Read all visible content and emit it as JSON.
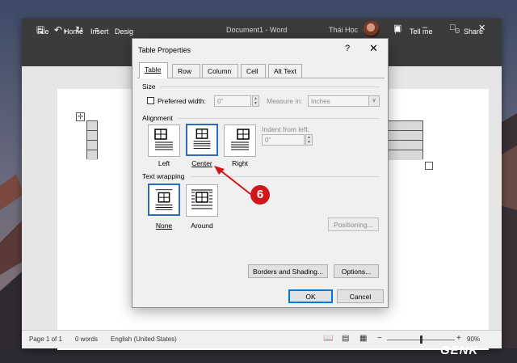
{
  "word": {
    "title": "Document1 - Word",
    "user": "Thái Học",
    "ribbon": {
      "file": "File",
      "home": "Home",
      "insert": "Insert",
      "design": "Desig",
      "tell_me": "Tell me",
      "share": "Share"
    },
    "status": {
      "page": "Page 1 of 1",
      "words": "0 words",
      "language": "English (United States)",
      "zoom": "90%"
    }
  },
  "dialog": {
    "title": "Table Properties",
    "help": "?",
    "close": "✕",
    "tabs": [
      {
        "label": "Table"
      },
      {
        "label": "Row"
      },
      {
        "label": "Column"
      },
      {
        "label": "Cell"
      },
      {
        "label": "Alt Text"
      }
    ],
    "size": {
      "heading": "Size",
      "preferred_width_label": "Preferred width:",
      "preferred_width_value": "0\"",
      "measure_in_label": "Measure in:",
      "measure_in_value": "Inches"
    },
    "alignment": {
      "heading": "Alignment",
      "options": [
        {
          "label": "Left"
        },
        {
          "label": "Center"
        },
        {
          "label": "Right"
        }
      ],
      "selected": "Center",
      "indent_label": "Indent from left:",
      "indent_value": "0\""
    },
    "text_wrapping": {
      "heading": "Text wrapping",
      "options": [
        {
          "label": "None"
        },
        {
          "label": "Around"
        }
      ],
      "selected": "None",
      "positioning": "Positioning..."
    },
    "buttons": {
      "borders": "Borders and Shading...",
      "options": "Options...",
      "ok": "OK",
      "cancel": "Cancel"
    }
  },
  "annotation": {
    "step": "6",
    "color": "#d0151b"
  },
  "watermark": "GENK"
}
